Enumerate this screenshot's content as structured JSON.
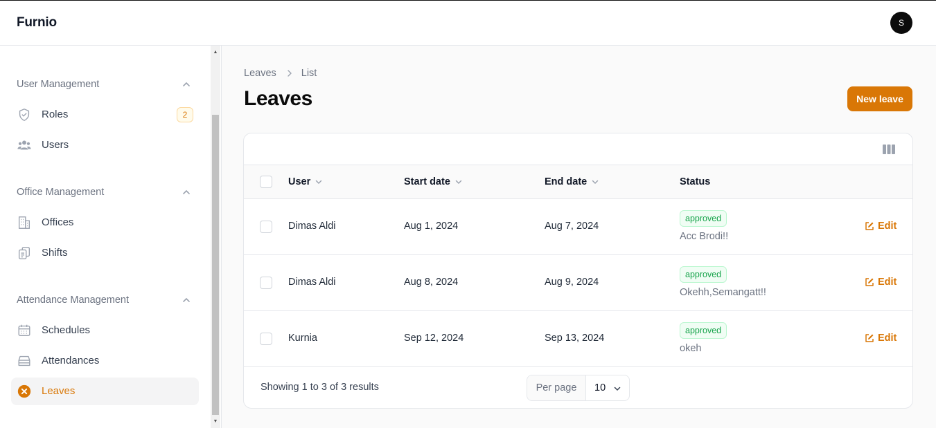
{
  "app": {
    "brand": "Furnio",
    "avatar_initial": "S"
  },
  "sidebar": {
    "groups": [
      {
        "label": "User Management",
        "items": [
          {
            "label": "Roles",
            "icon": "shield-icon",
            "badge": "2"
          },
          {
            "label": "Users",
            "icon": "user-group-icon"
          }
        ]
      },
      {
        "label": "Office Management",
        "items": [
          {
            "label": "Offices",
            "icon": "building-icon"
          },
          {
            "label": "Shifts",
            "icon": "clipboard-copy-icon"
          }
        ]
      },
      {
        "label": "Attendance Management",
        "items": [
          {
            "label": "Schedules",
            "icon": "calendar-icon"
          },
          {
            "label": "Attendances",
            "icon": "inbox-stack-icon"
          },
          {
            "label": "Leaves",
            "icon": "x-circle-icon",
            "active": true
          }
        ]
      }
    ]
  },
  "breadcrumb": {
    "parent": "Leaves",
    "current": "List"
  },
  "page": {
    "title": "Leaves",
    "new_button": "New leave"
  },
  "table": {
    "headers": {
      "user": "User",
      "start_date": "Start date",
      "end_date": "End date",
      "status": "Status"
    },
    "rows": [
      {
        "user": "Dimas Aldi",
        "start_date": "Aug 1, 2024",
        "end_date": "Aug 7, 2024",
        "status": "approved",
        "note": "Acc Brodi!!",
        "action": "Edit"
      },
      {
        "user": "Dimas Aldi",
        "start_date": "Aug 8, 2024",
        "end_date": "Aug 9, 2024",
        "status": "approved",
        "note": "Okehh,Semangatt!!",
        "action": "Edit"
      },
      {
        "user": "Kurnia",
        "start_date": "Sep 12, 2024",
        "end_date": "Sep 13, 2024",
        "status": "approved",
        "note": "okeh",
        "action": "Edit"
      }
    ]
  },
  "pagination": {
    "summary": "Showing 1 to 3 of 3 results",
    "per_page_label": "Per page",
    "per_page_value": "10"
  },
  "colors": {
    "accent": "#d97706",
    "success": "#16a34a"
  }
}
